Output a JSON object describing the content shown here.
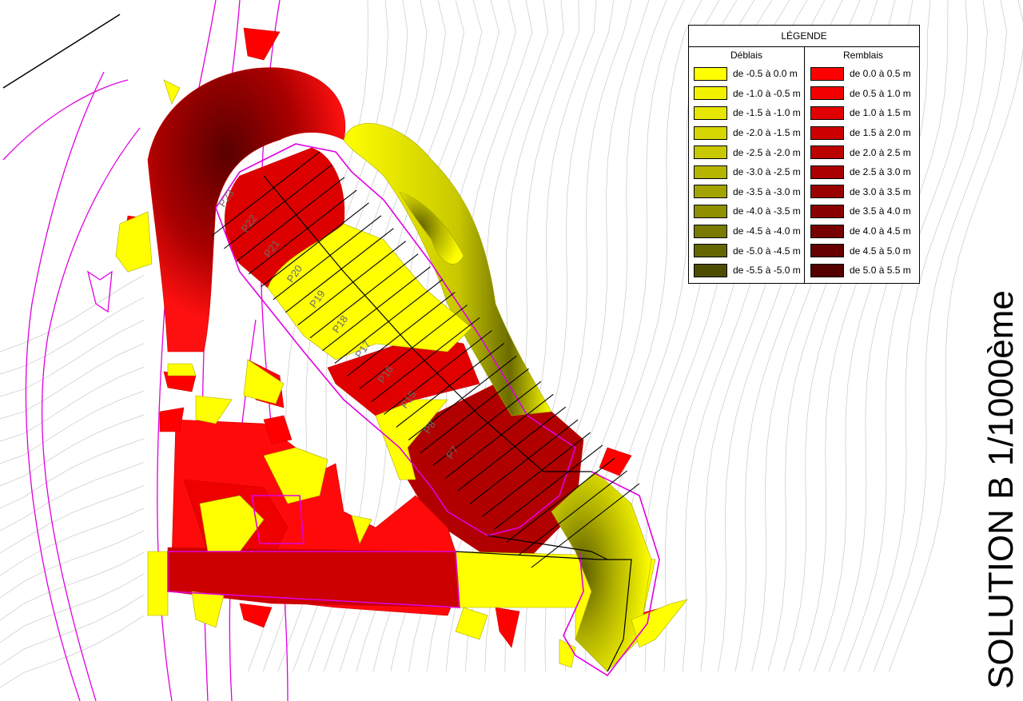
{
  "title": "SOLUTION B 1/1000ème",
  "legend": {
    "title": "LÉGENDE",
    "deblais": {
      "header": "Déblais",
      "items": [
        {
          "label": "de -0.5 à 0.0 m",
          "color": "#ffff00"
        },
        {
          "label": "de -1.0 à -0.5 m",
          "color": "#f2f200"
        },
        {
          "label": "de -1.5 à -1.0 m",
          "color": "#e6e600"
        },
        {
          "label": "de -2.0 à -1.5 m",
          "color": "#d6d600"
        },
        {
          "label": "de -2.5 à -2.0 m",
          "color": "#c8c800"
        },
        {
          "label": "de -3.0 à -2.5 m",
          "color": "#b5b500"
        },
        {
          "label": "de -3.5 à -3.0 m",
          "color": "#a3a300"
        },
        {
          "label": "de -4.0 à -3.5 m",
          "color": "#8f8f00"
        },
        {
          "label": "de -4.5 à -4.0 m",
          "color": "#7a7a00"
        },
        {
          "label": "de -5.0 à -4.5 m",
          "color": "#666600"
        },
        {
          "label": "de -5.5 à -5.0 m",
          "color": "#4d4d00"
        }
      ]
    },
    "remblais": {
      "header": "Remblais",
      "items": [
        {
          "label": "de 0.0 à 0.5 m",
          "color": "#ff0000"
        },
        {
          "label": "de 0.5 à 1.0 m",
          "color": "#f20000"
        },
        {
          "label": "de 1.0 à 1.5 m",
          "color": "#e00000"
        },
        {
          "label": "de 1.5 à 2.0 m",
          "color": "#cc0000"
        },
        {
          "label": "de 2.0 à 2.5 m",
          "color": "#bb0000"
        },
        {
          "label": "de 2.5 à 3.0 m",
          "color": "#aa0000"
        },
        {
          "label": "de 3.0 à 3.5 m",
          "color": "#990000"
        },
        {
          "label": "de 3.5 à 4.0 m",
          "color": "#880000"
        },
        {
          "label": "de 4.0 à 4.5 m",
          "color": "#770000"
        },
        {
          "label": "de 4.5 à 5.0 m",
          "color": "#660000"
        },
        {
          "label": "de 5.0 à 5.5 m",
          "color": "#550000"
        }
      ]
    }
  },
  "profiles": [
    "P23",
    "P22",
    "P21",
    "P20",
    "P19",
    "P18",
    "P17",
    "P16",
    "P15",
    "P8",
    "P7"
  ]
}
